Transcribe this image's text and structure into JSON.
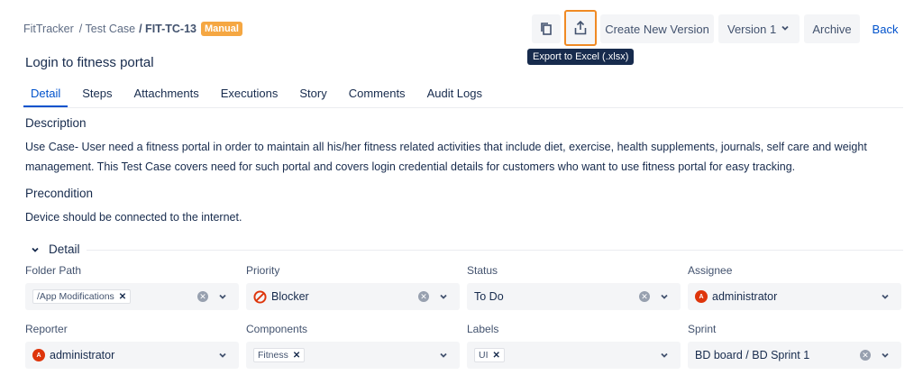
{
  "breadcrumb": {
    "project": "FitTracker",
    "section": "/ Test Case",
    "key": "/ FIT-TC-13",
    "badge": "Manual"
  },
  "toolbar": {
    "copy_icon": "copy-icon",
    "export_icon": "export-icon",
    "create_version_label": "Create New Version",
    "version_label": "Version 1",
    "archive_label": "Archive",
    "back_label": "Back",
    "tooltip": "Export to Excel (.xlsx)",
    "highlight_color": "#f08a24"
  },
  "page": {
    "title": "Login to fitness portal"
  },
  "tabs": [
    {
      "label": "Detail",
      "active": true
    },
    {
      "label": "Steps"
    },
    {
      "label": "Attachments"
    },
    {
      "label": "Executions"
    },
    {
      "label": "Story"
    },
    {
      "label": "Comments"
    },
    {
      "label": "Audit Logs"
    }
  ],
  "description": {
    "heading": "Description",
    "text": "Use Case- User need a fitness portal in order to maintain all his/her fitness related activities that include diet, exercise, health supplements, journals, self care and weight management. This Test Case covers need for such portal and covers login credential details for customers who want to use fitness portal for easy tracking."
  },
  "precondition": {
    "heading": "Precondition",
    "text": "Device should be connected to the internet."
  },
  "detail": {
    "heading": "Detail",
    "fields": {
      "folder_path": {
        "label": "Folder Path",
        "value": "/App Modifications"
      },
      "priority": {
        "label": "Priority",
        "value": "Blocker",
        "icon": "blocker-icon",
        "color": "#de350b"
      },
      "status": {
        "label": "Status",
        "value": "To Do"
      },
      "assignee": {
        "label": "Assignee",
        "value": "administrator",
        "avatar": "A"
      },
      "reporter": {
        "label": "Reporter",
        "value": "administrator",
        "avatar": "A"
      },
      "components": {
        "label": "Components",
        "value": "Fitness"
      },
      "labels": {
        "label": "Labels",
        "value": "UI"
      },
      "sprint": {
        "label": "Sprint",
        "value": "BD board / BD Sprint 1"
      }
    }
  }
}
